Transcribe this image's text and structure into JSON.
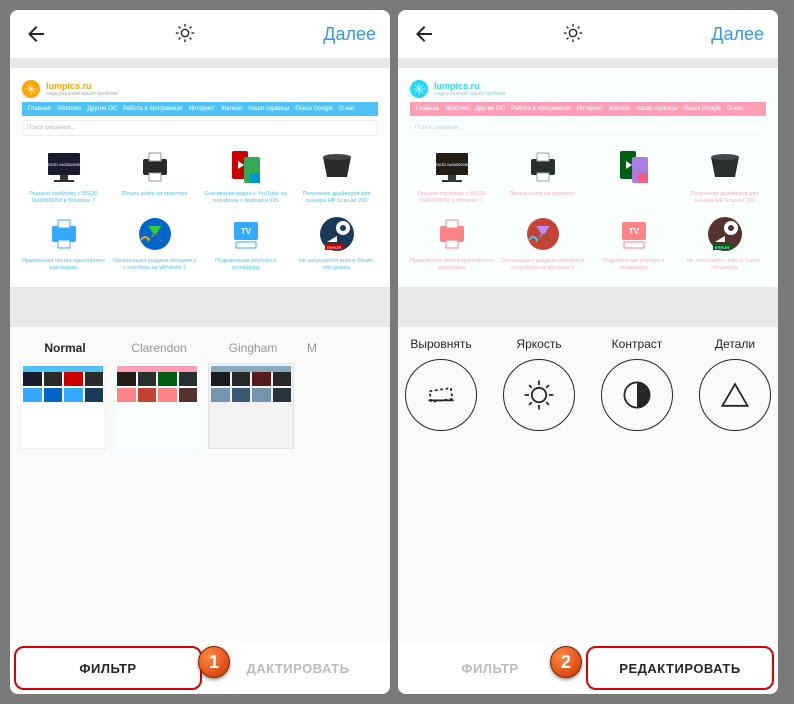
{
  "header": {
    "next": "Далее"
  },
  "site": {
    "name": "lumpics.ru",
    "tagline": "сюда решений ваших проблем",
    "nav": [
      "Главная",
      "Windows",
      "Другие ОС",
      "Работа в программах",
      "Интернет",
      "Железо",
      "Наши сервисы",
      "Поиск Google",
      "О нас"
    ],
    "search_ph": "Поиск решения...",
    "items": [
      {
        "label": "Решаем проблему с BSOD 0x00000050 в Windows 7"
      },
      {
        "label": "Печать книги на принтере"
      },
      {
        "label": "Скачивание видео с YouTube на телефоны с Android и iOS"
      },
      {
        "label": "Получение драйверов для сканера HP ScanJet 200"
      },
      {
        "label": "Правильная чистка принтерного картриджа"
      },
      {
        "label": "Организация раздачи интернета с ноутбука на Windows 7"
      },
      {
        "label": "Подключение роутера к телевизору"
      },
      {
        "label": "Не запускается игра в Steam: что делать"
      }
    ]
  },
  "filters": [
    {
      "name": "Normal",
      "active": true
    },
    {
      "name": "Clarendon",
      "active": false
    },
    {
      "name": "Gingham",
      "active": false
    },
    {
      "name": "M",
      "active": false
    }
  ],
  "edit_tools": [
    {
      "name": "Выровнять"
    },
    {
      "name": "Яркость"
    },
    {
      "name": "Контраст"
    },
    {
      "name": "Детали"
    }
  ],
  "tabs": {
    "filter": "ФИЛЬТР",
    "edit": "ДАКТИРОВАТЬ",
    "edit_full": "РЕДАКТИРОВАТЬ"
  },
  "badges": {
    "one": "1",
    "two": "2"
  }
}
